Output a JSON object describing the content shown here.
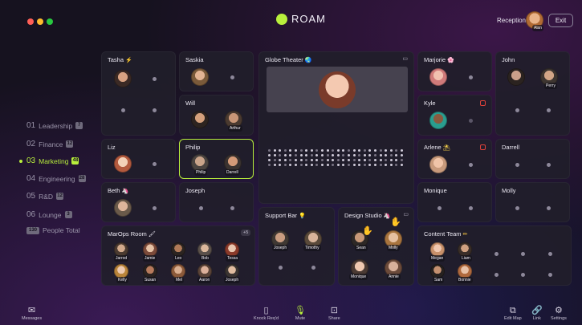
{
  "window": {
    "controls": [
      "close",
      "minimize",
      "maximize"
    ]
  },
  "header": {
    "logo_text": "ROAM",
    "reception_label": "Reception",
    "reception_avatar_name": "Alan",
    "exit_label": "Exit"
  },
  "floors": [
    {
      "num": "01",
      "label": "Leadership",
      "badge": "7",
      "active": false
    },
    {
      "num": "02",
      "label": "Finance",
      "badge": "12",
      "active": false
    },
    {
      "num": "03",
      "label": "Marketing",
      "badge": "48",
      "active": true
    },
    {
      "num": "04",
      "label": "Engineering",
      "badge": "28",
      "active": false
    },
    {
      "num": "05",
      "label": "R&D",
      "badge": "12",
      "active": false
    },
    {
      "num": "06",
      "label": "Lounge",
      "badge": "3",
      "active": false
    }
  ],
  "people_total": {
    "badge": "130",
    "label": "People Total"
  },
  "rooms": {
    "tasha": {
      "name": "Tasha",
      "emoji": "⚡"
    },
    "saskia": {
      "name": "Saskia"
    },
    "will": {
      "name": "Will",
      "occupant": "Arthur"
    },
    "liz": {
      "name": "Liz"
    },
    "philip": {
      "name": "Philip",
      "occupants": [
        "Philip",
        "Darrell"
      ]
    },
    "beth": {
      "name": "Beth",
      "emoji": "🦄"
    },
    "joseph": {
      "name": "Joseph"
    },
    "globe": {
      "name": "Globe Theater",
      "emoji": "🌏"
    },
    "marjorie": {
      "name": "Marjorie",
      "emoji": "🌸"
    },
    "john": {
      "name": "John",
      "occupant": "Perry"
    },
    "kyle": {
      "name": "Kyle"
    },
    "arlene": {
      "name": "Arlene",
      "emoji": "⛱"
    },
    "darrell": {
      "name": "Darrell"
    },
    "monique": {
      "name": "Monique"
    },
    "molly": {
      "name": "Molly"
    },
    "support": {
      "name": "Support Bar",
      "emoji": "💡",
      "occupants": [
        "Joseph",
        "Timothy"
      ]
    },
    "design": {
      "name": "Design Studio",
      "emoji": "🦄",
      "occupants": [
        "Sean",
        "Molly",
        "Monique",
        "Annie"
      ]
    },
    "marops": {
      "name": "MarOps Room",
      "emoji": "🖌",
      "extra": "+5",
      "occupants": [
        "Jarrod",
        "Jamie",
        "Leo",
        "Bob",
        "Tessa",
        "Kelly",
        "Susan",
        "Mel",
        "Aaron",
        "Joseph"
      ]
    },
    "content": {
      "name": "Content Team",
      "emoji": "✏",
      "occupants": [
        "Megan",
        "Liam",
        "Sam",
        "Bonnie"
      ]
    }
  },
  "bottom_bar": {
    "messages": "Messages",
    "knock": "Knock Req'd",
    "mute": "Mute",
    "share": "Share",
    "edit_map": "Edit Map",
    "link": "Link",
    "settings": "Settings"
  },
  "colors": {
    "accent": "#b9f03c",
    "background": "#16121f",
    "room": "#211e2a"
  }
}
